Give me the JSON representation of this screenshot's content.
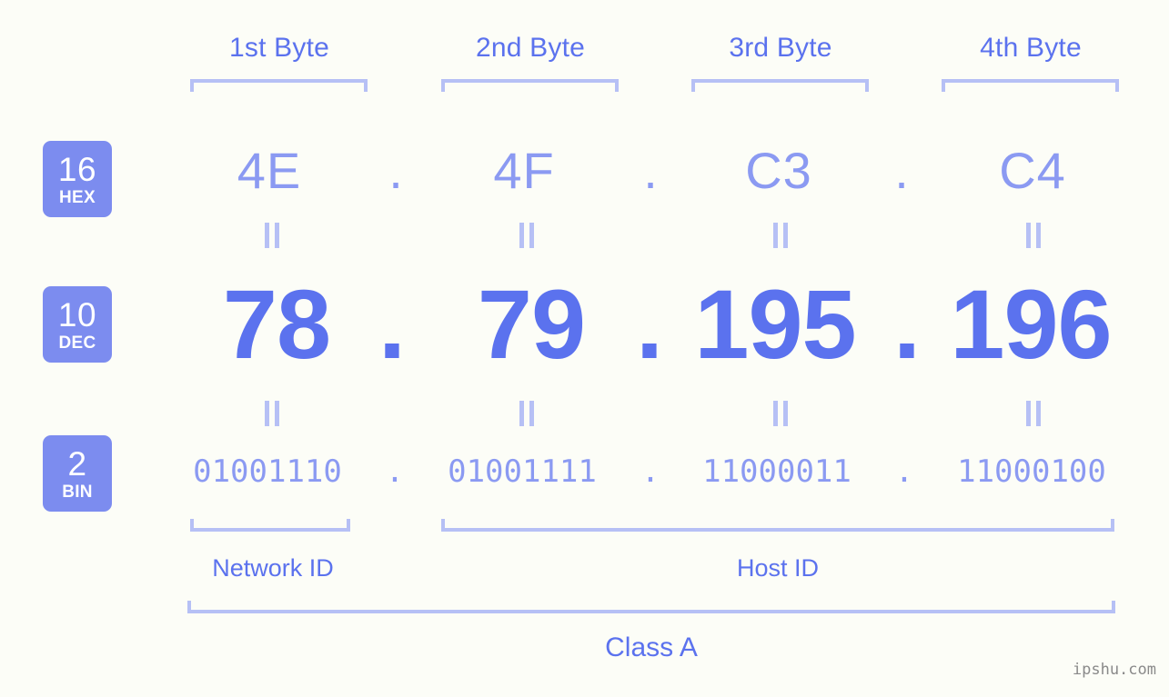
{
  "background_color": "#fcfdf7",
  "accent_color": "#5b72ee",
  "accent_light_color": "#8b9af2",
  "bracket_color": "#b6c0f5",
  "badge_color": "#7c8cef",
  "byte_headers": [
    {
      "label": "1st Byte"
    },
    {
      "label": "2nd Byte"
    },
    {
      "label": "3rd Byte"
    },
    {
      "label": "4th Byte"
    }
  ],
  "rows": {
    "hex": {
      "base_number": "16",
      "base_name": "HEX",
      "values": [
        "4E",
        "4F",
        "C3",
        "C4"
      ],
      "separator": "."
    },
    "dec": {
      "base_number": "10",
      "base_name": "DEC",
      "values": [
        "78",
        "79",
        "195",
        "196"
      ],
      "separator": "."
    },
    "bin": {
      "base_number": "2",
      "base_name": "BIN",
      "values": [
        "01001110",
        "01001111",
        "11000011",
        "11000100"
      ],
      "separator": "."
    }
  },
  "equality_marker": "=",
  "sections": {
    "network_id": "Network ID",
    "host_id": "Host ID"
  },
  "class_label": "Class A",
  "watermark": "ipshu.com"
}
